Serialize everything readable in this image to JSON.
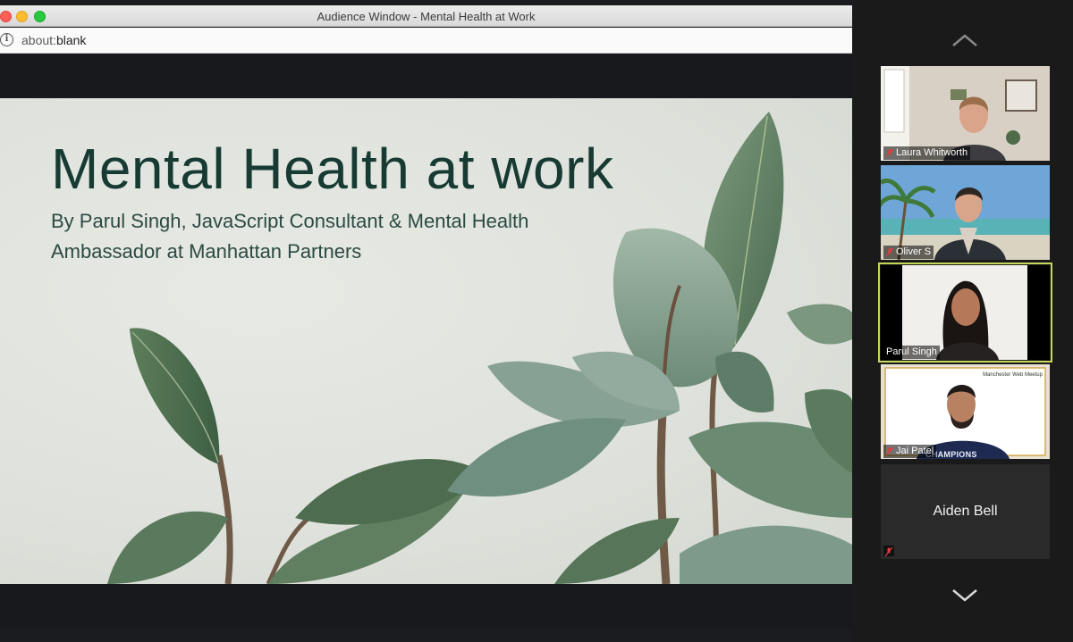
{
  "window": {
    "title": "Audience Window - Mental Health at Work",
    "url_scheme": "about:",
    "url_path": "blank"
  },
  "slide": {
    "title": "Mental Health at work",
    "subtitle_line1": "By Parul Singh, JavaScript Consultant & Mental Health",
    "subtitle_line2": "Ambassador at Manhattan Partners"
  },
  "participants": [
    {
      "name": "Laura Whitworth",
      "muted": true,
      "video": true
    },
    {
      "name": "Oliver S",
      "muted": true,
      "video": true
    },
    {
      "name": "Parul Singh",
      "muted": false,
      "video": true,
      "active_speaker": true
    },
    {
      "name": "Jai Patel",
      "muted": true,
      "video": true,
      "shirt_text": "CHAMPIONS",
      "screen_text": "Manchester Web Meetup"
    },
    {
      "name": "Aiden Bell",
      "muted": true,
      "video": false
    }
  ],
  "colors": {
    "active_speaker_border": "#c6d85a",
    "muted_icon": "#e23c3c",
    "slide_title": "#173b33"
  },
  "icons": {
    "scroll_up": "chevron-up-icon",
    "scroll_down": "chevron-down-icon",
    "muted": "mic-off-icon",
    "site_info": "info-icon"
  }
}
